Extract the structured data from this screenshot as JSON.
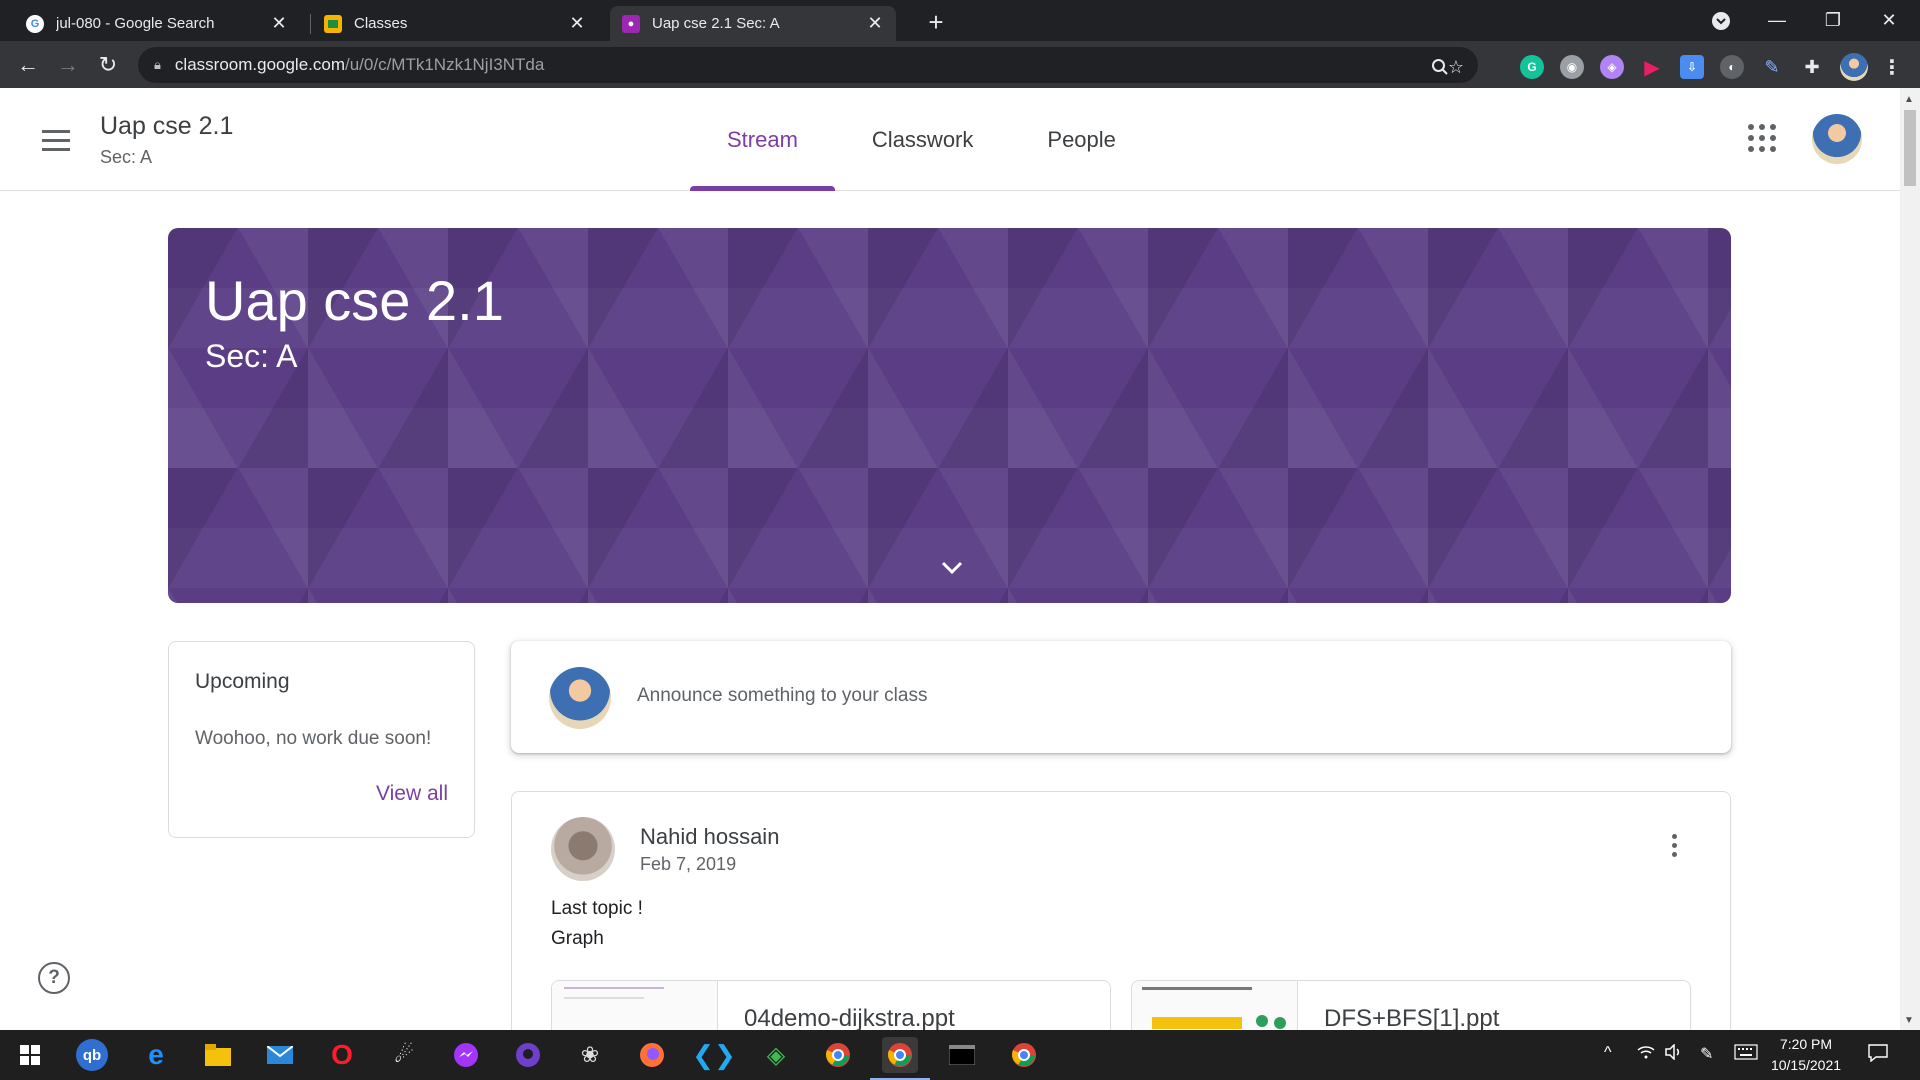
{
  "browser": {
    "tabs": [
      {
        "title": "jul-080 - Google Search",
        "favicon": "G",
        "favicon_color": "#ffffff"
      },
      {
        "title": "Classes",
        "favicon": "",
        "favicon_color": "#f4b400"
      },
      {
        "title": "Uap cse 2.1 Sec: A",
        "favicon": "",
        "favicon_color": "#9c27b0"
      }
    ],
    "url_host": "classroom.google.com",
    "url_path": "/u/0/c/MTk1Nzk1NjI3NTda"
  },
  "header": {
    "class_title": "Uap cse 2.1",
    "class_section": "Sec: A",
    "tabs": [
      {
        "label": "Stream",
        "active": true
      },
      {
        "label": "Classwork",
        "active": false
      },
      {
        "label": "People",
        "active": false
      }
    ]
  },
  "banner": {
    "title": "Uap cse 2.1",
    "section": "Sec: A",
    "color": "#5a3d85"
  },
  "upcoming": {
    "heading": "Upcoming",
    "message": "Woohoo, no work due soon!",
    "view_all": "View all"
  },
  "announce": {
    "placeholder": "Announce something to your class"
  },
  "post": {
    "author": "Nahid hossain",
    "date": "Feb 7, 2019",
    "lines": [
      "Last topic !",
      "Graph"
    ],
    "attachments": [
      {
        "name": "04demo-dijkstra.ppt"
      },
      {
        "name": "DFS+BFS[1].ppt"
      }
    ]
  },
  "taskbar": {
    "time": "7:20 PM",
    "date": "10/15/2021"
  },
  "colors": {
    "accent": "#7b3fa3",
    "chrome_dark": "#202124",
    "chrome_toolbar": "#35363a"
  }
}
